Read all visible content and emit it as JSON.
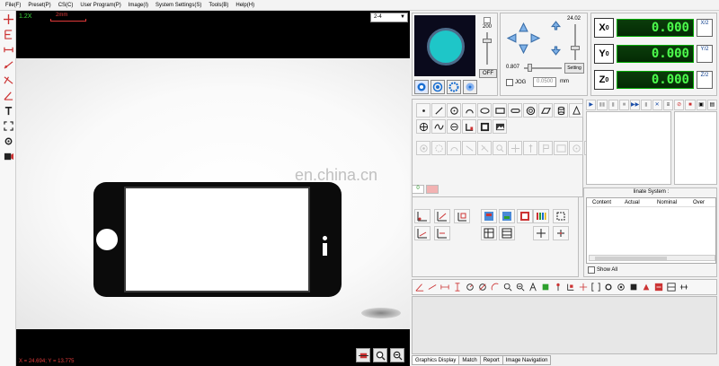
{
  "menu": [
    "File(F)",
    "Preset(P)",
    "CS(C)",
    "User Program(P)",
    "Image(I)",
    "System Settings(S)",
    "Tools(B)",
    "Help(H)"
  ],
  "camera": {
    "zoom": "1.2X",
    "scale": "2mm",
    "selected_view": "2-4",
    "watermark": "en.china.cn",
    "coordinates": "X = 24.694; Y = 13.775"
  },
  "light": {
    "brightness": "200",
    "off_label": "OFF"
  },
  "motion": {
    "z_value": "24.02",
    "speed_value": "0.807",
    "setting_label": "Setting",
    "jog_label": "JOG",
    "step_placeholder": "0.0500",
    "unit": "mm"
  },
  "dro": [
    {
      "axis": "X",
      "value": "0.000",
      "half": "X/2"
    },
    {
      "axis": "Y",
      "value": "0.000",
      "half": "Y/2"
    },
    {
      "axis": "Z",
      "value": "0.000",
      "half": "Z/2"
    }
  ],
  "coordinate_panel": {
    "title": "linate System :",
    "columns": [
      "Content",
      "Actual",
      "Nominal",
      "Over"
    ],
    "show_all": "Show All"
  },
  "tabs": [
    "Graphics Display",
    "Match",
    "Report",
    "Image Navigation"
  ],
  "colors": {
    "lcd_text": "#4dff4d",
    "zoom_text": "#3cdc3c",
    "readout_text": "#e23a3a",
    "ring": "#1ec6c8"
  }
}
